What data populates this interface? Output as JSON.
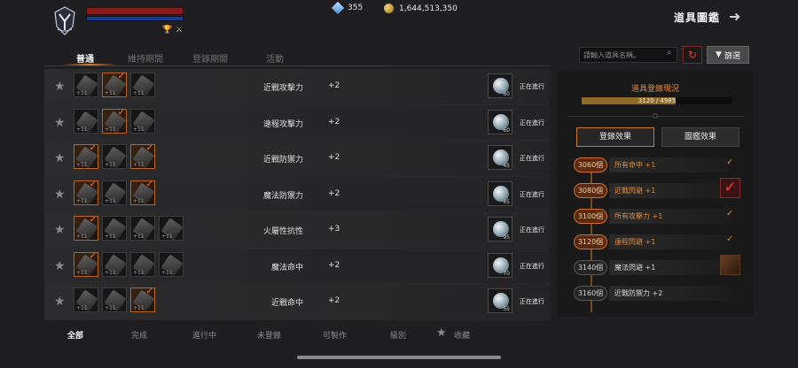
{
  "header": {
    "gems": "355",
    "gold": "1,644,513,350",
    "title": "道具圖鑑"
  },
  "tabs": [
    "普通",
    "維持期間",
    "登錄期間",
    "活動"
  ],
  "search": {
    "placeholder": "請輸入道具名稱。"
  },
  "filter_label": "篩選",
  "items": [
    {
      "stat": "近戰攻擊力",
      "value": "+2",
      "potions": "60",
      "status": "正在進行",
      "slots": [
        false,
        true,
        false
      ]
    },
    {
      "stat": "遠程攻擊力",
      "value": "+2",
      "potions": "60",
      "status": "正在進行",
      "slots": [
        false,
        true,
        false
      ]
    },
    {
      "stat": "近戰防禦力",
      "value": "+2",
      "potions": "45",
      "status": "正在進行",
      "slots": [
        true,
        false,
        true
      ]
    },
    {
      "stat": "魔法防禦力",
      "value": "+2",
      "potions": "45",
      "status": "正在進行",
      "slots": [
        true,
        false,
        true
      ]
    },
    {
      "stat": "火屬性抗性",
      "value": "+3",
      "potions": "95",
      "status": "正在進行",
      "slots": [
        true,
        false,
        false,
        false
      ]
    },
    {
      "stat": "魔法命中",
      "value": "+2",
      "potions": "70",
      "status": "正在進行",
      "slots": [
        true,
        false,
        false,
        false
      ]
    },
    {
      "stat": "近戰命中",
      "value": "+2",
      "potions": "55",
      "status": "正在進行",
      "slots": [
        false,
        false,
        true
      ]
    }
  ],
  "panel": {
    "title": "道具登錄現況",
    "progress_text": "3120 / 4985",
    "progress": 0.626,
    "tabs": [
      "登錄效果",
      "圖鑑效果"
    ],
    "milestones": [
      {
        "count": "3060個",
        "effect": "所有命中 +1",
        "state": "done"
      },
      {
        "count": "3080個",
        "effect": "近戰閃避 +1",
        "state": "claim"
      },
      {
        "count": "3100個",
        "effect": "所有攻擊力 +1",
        "state": "done"
      },
      {
        "count": "3120個",
        "effect": "遠程閃避 +1",
        "state": "done"
      },
      {
        "count": "3140個",
        "effect": "魔法閃避 +1",
        "state": "reward"
      },
      {
        "count": "3160個",
        "effect": "近戰防禦力 +2",
        "state": "none"
      }
    ]
  },
  "bottom_filters": [
    "全部",
    "完成",
    "進行中",
    "未登錄",
    "可製作",
    "級別",
    "收藏"
  ],
  "colors": {
    "accent": "#e07a2c",
    "claim": "#ff3a28"
  }
}
